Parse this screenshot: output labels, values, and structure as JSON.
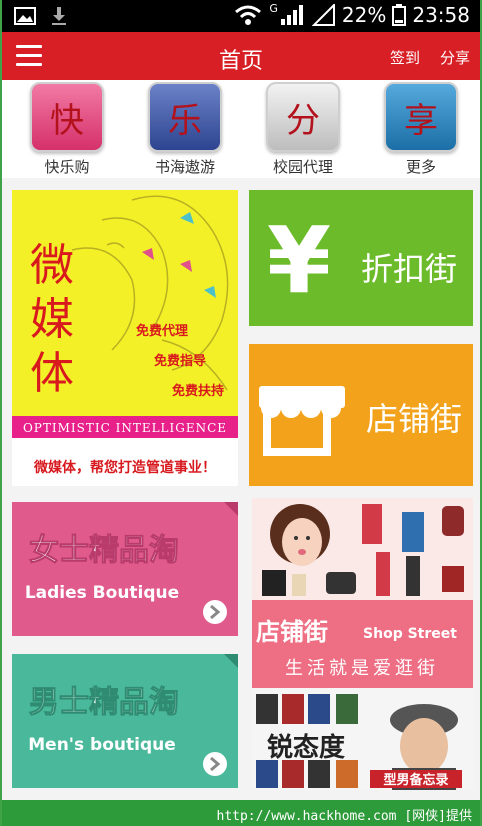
{
  "status": {
    "battery": "22%",
    "time": "23:58",
    "network": "G"
  },
  "appbar": {
    "title": "首页",
    "checkin": "签到",
    "share": "分享"
  },
  "categories": [
    {
      "char": "快",
      "label": "快乐购",
      "color": "#e0457b"
    },
    {
      "char": "乐",
      "label": "书海遨游",
      "color": "#3d57a5"
    },
    {
      "char": "分",
      "label": "校园代理",
      "color": "#d9d9d9"
    },
    {
      "char": "享",
      "label": "更多",
      "color": "#2a8ac2"
    }
  ],
  "cards": {
    "wemedia": {
      "chars": [
        "微",
        "媒",
        "体"
      ],
      "lines": [
        "免费代理",
        "免费指导",
        "免费扶持"
      ],
      "banner": "OPTIMISTIC INTELLIGENCE",
      "slogan": "微媒体，帮您打造管道事业！"
    },
    "discount": {
      "symbol": "¥",
      "label": "折扣街",
      "color": "#6cbb2a"
    },
    "shop": {
      "label": "店铺街",
      "color": "#f3a31b"
    },
    "ladies": {
      "title": "女士精品淘",
      "subtitle": "Ladies Boutique",
      "color": "#e05a8c"
    },
    "men": {
      "title": "男士精品淘",
      "subtitle": "Men's boutique",
      "color": "#4ab89a"
    },
    "shopstreet": {
      "title": "店铺街",
      "subtitle": "Shop Street",
      "tagline": "生活就是爱逛街",
      "color": "#ee6f84"
    },
    "ruitai": {
      "title": "锐态度",
      "subtitle": "型男备忘录"
    }
  },
  "footer": {
    "source": "http://www.hackhome.com [网侠]提供"
  }
}
